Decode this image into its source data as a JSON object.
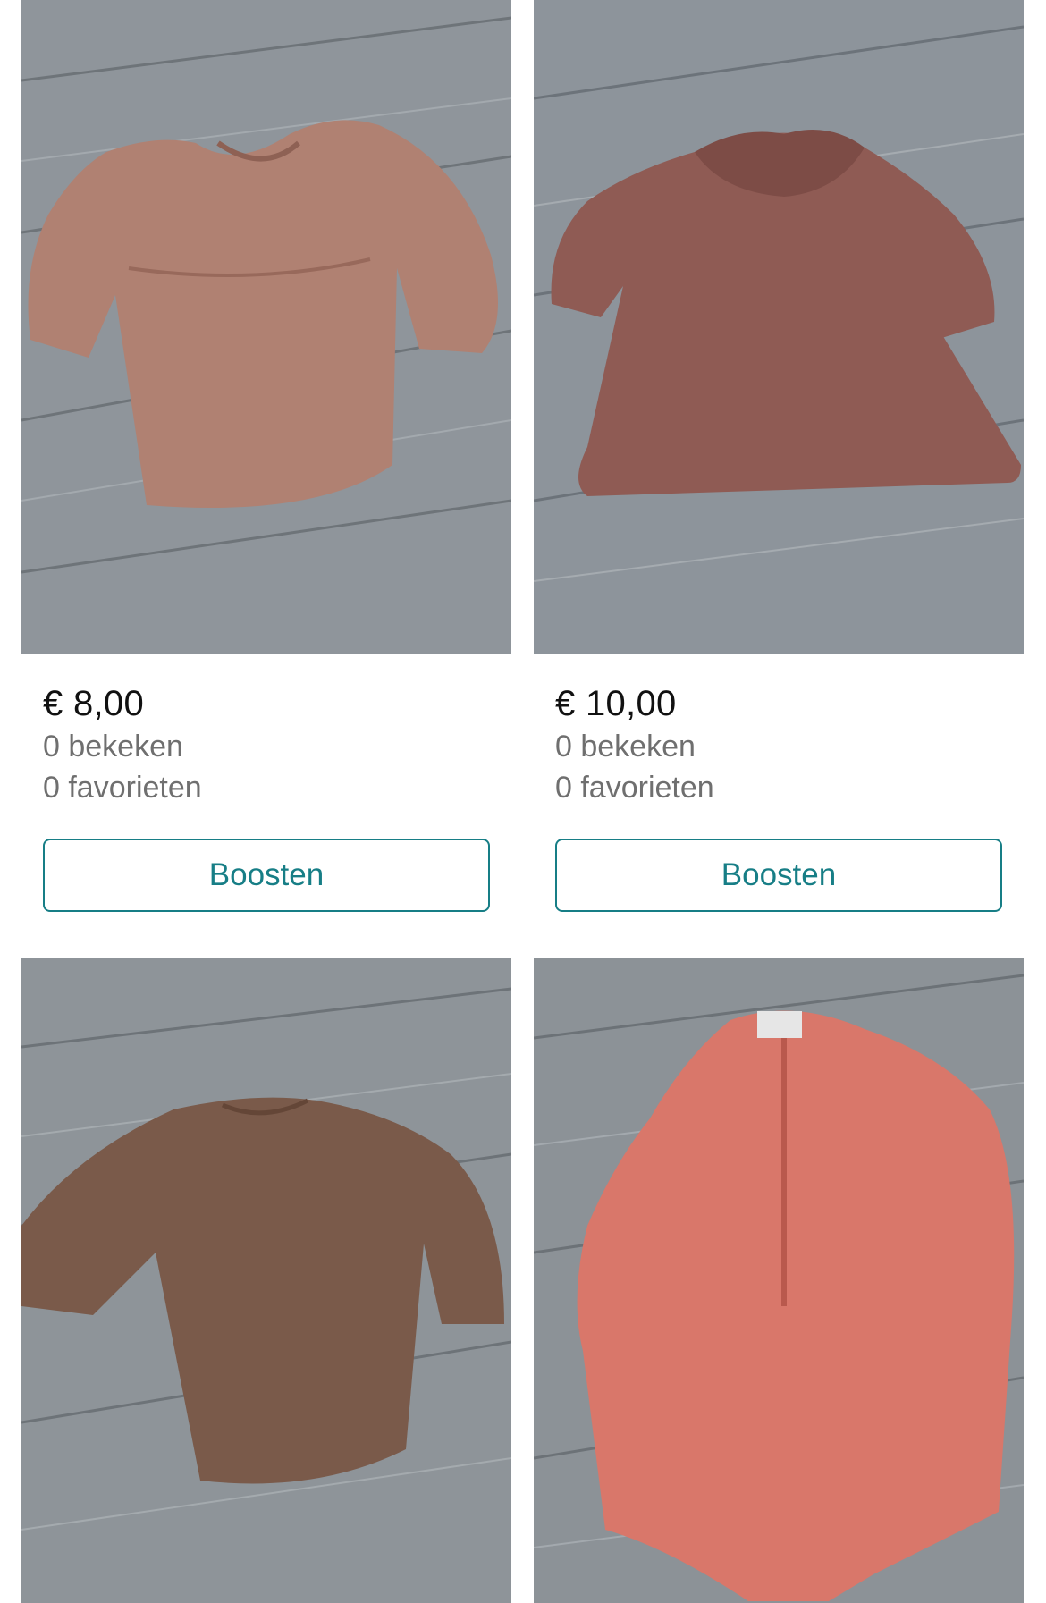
{
  "items": [
    {
      "price": "€ 8,00",
      "views": "0 bekeken",
      "favorites": "0 favorieten",
      "boost_label": "Boosten",
      "garment_color": "#b08172"
    },
    {
      "price": "€ 10,00",
      "views": "0 bekeken",
      "favorites": "0 favorieten",
      "boost_label": "Boosten",
      "garment_color": "#8f5b54"
    },
    {
      "garment_color": "#7a5a4a"
    },
    {
      "garment_color": "#d9776a"
    }
  ]
}
